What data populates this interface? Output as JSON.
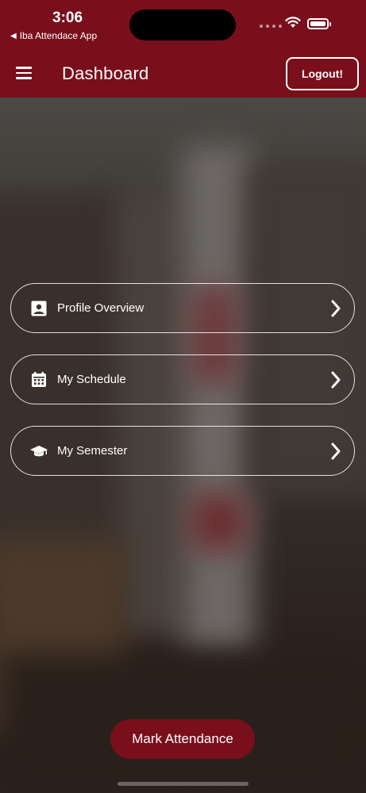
{
  "status": {
    "time": "3:06",
    "back_app": "Iba Attendace App"
  },
  "header": {
    "title": "Dashboard",
    "logout_label": "Logout!"
  },
  "menu": [
    {
      "label": "Profile Overview",
      "icon": "profile-icon"
    },
    {
      "label": "My Schedule",
      "icon": "calendar-icon"
    },
    {
      "label": "My Semester",
      "icon": "graduation-cap-icon"
    }
  ],
  "actions": {
    "mark_attendance": "Mark Attendance"
  },
  "colors": {
    "brand": "#7a0f1c",
    "text": "#ffffff"
  }
}
